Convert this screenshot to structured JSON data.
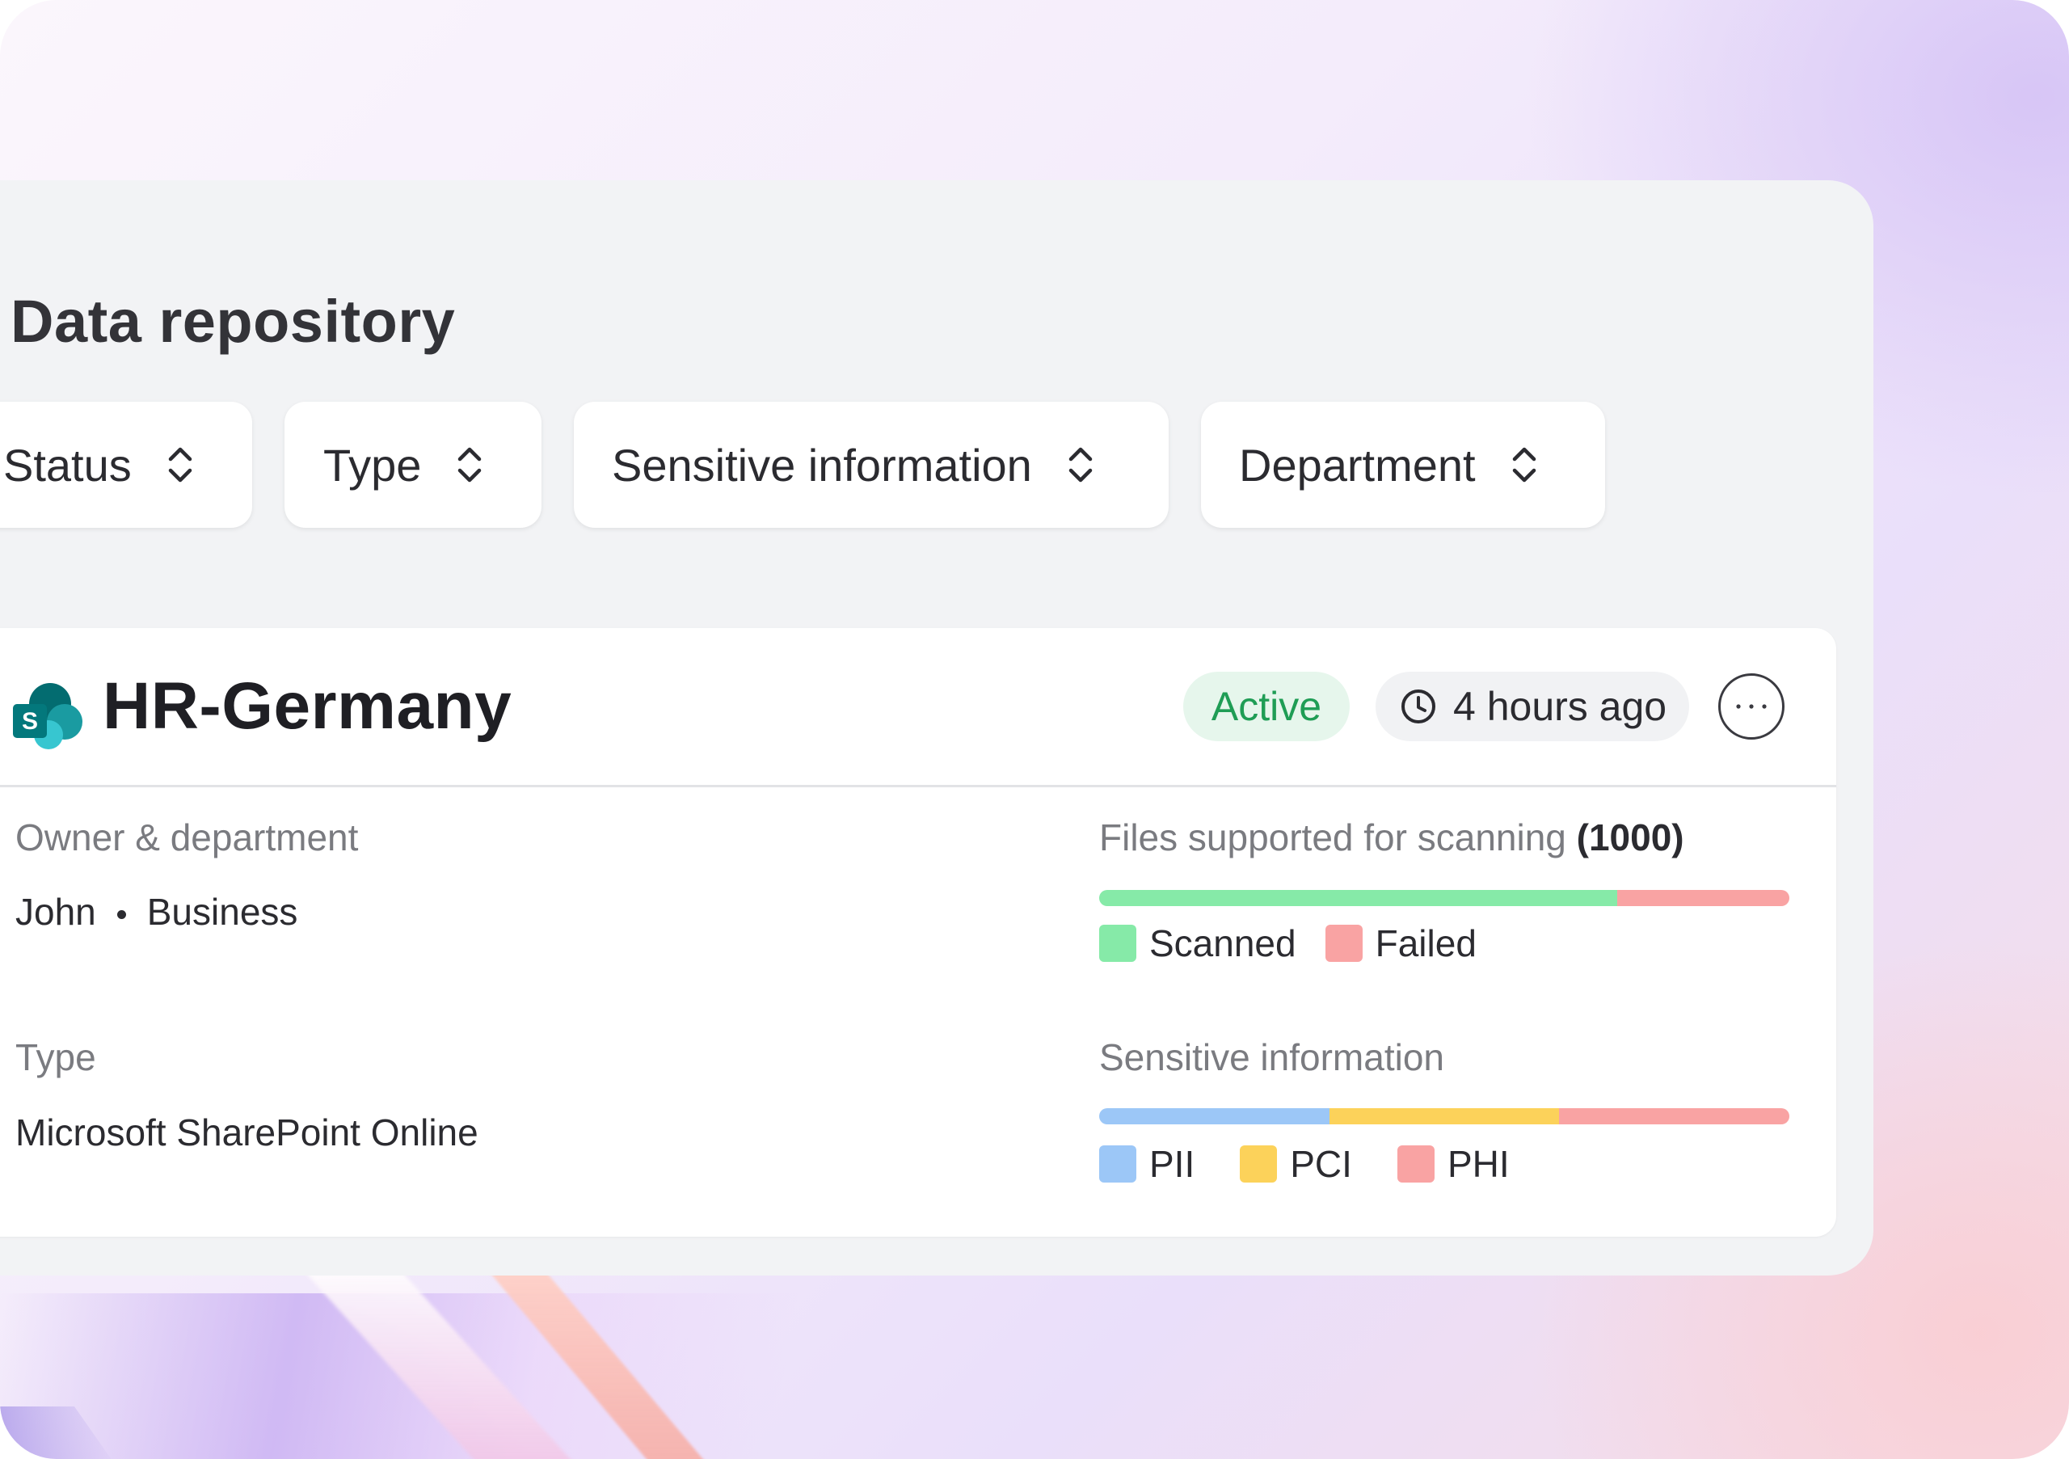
{
  "page": {
    "title": "Data repository"
  },
  "filters": [
    {
      "label": "Status"
    },
    {
      "label": "Type"
    },
    {
      "label": "Sensitive information"
    },
    {
      "label": "Department"
    }
  ],
  "repository": {
    "name": "HR-Germany",
    "icon": "sharepoint-icon",
    "status": "Active",
    "last_updated": "4 hours ago",
    "owner_label": "Owner & department",
    "owner": "John",
    "department": "Business",
    "type_label": "Type",
    "type": "Microsoft SharePoint Online",
    "files": {
      "label": "Files supported for scanning",
      "count": "(1000)",
      "segments": [
        {
          "name": "Scanned",
          "fraction": 0.75,
          "color": "#86eaa8"
        },
        {
          "name": "Failed",
          "fraction": 0.25,
          "color": "#f9a3a3"
        }
      ]
    },
    "sensitive": {
      "label": "Sensitive information",
      "segments": [
        {
          "name": "PII",
          "fraction": 0.3333,
          "color": "#9cc7f7"
        },
        {
          "name": "PCI",
          "fraction": 0.3333,
          "color": "#fcd25a"
        },
        {
          "name": "PHI",
          "fraction": 0.3334,
          "color": "#f9a3a3"
        }
      ]
    }
  },
  "colors": {
    "active_text": "#1f9d55",
    "active_bg": "#e6f6ec",
    "panel_bg": "#f2f3f5"
  }
}
